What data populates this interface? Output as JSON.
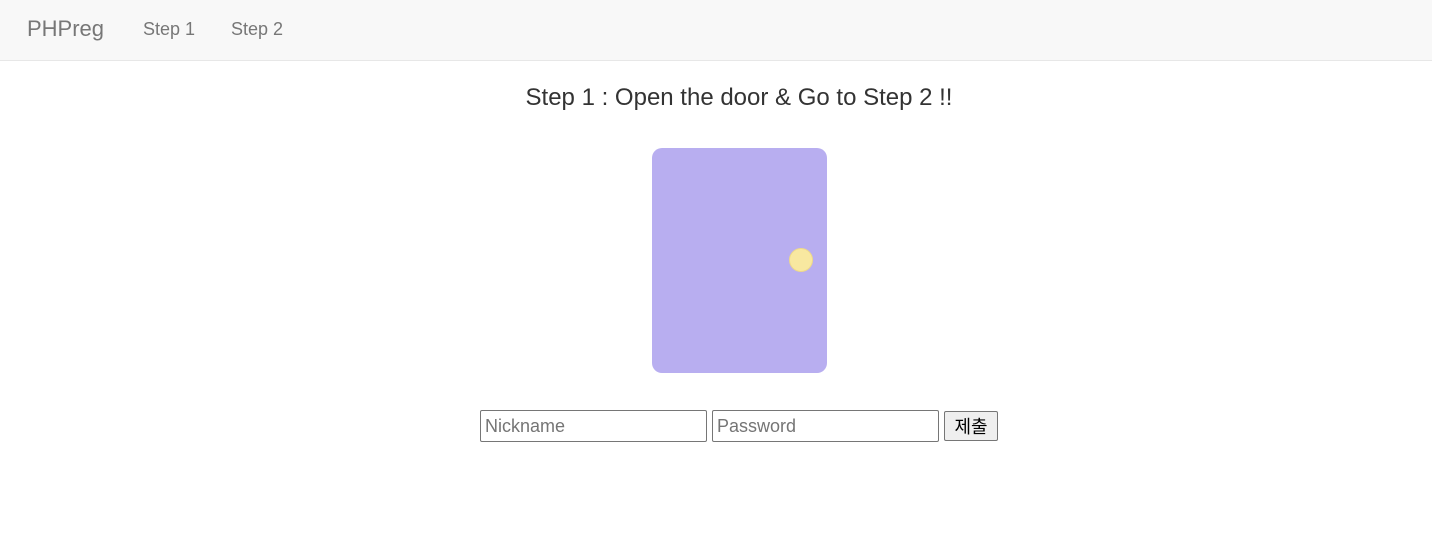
{
  "navbar": {
    "brand": "PHPreg",
    "links": [
      {
        "label": "Step 1"
      },
      {
        "label": "Step 2"
      }
    ]
  },
  "main": {
    "title": "Step 1 : Open the door & Go to Step 2 !!",
    "door": {
      "color": "#b8aef0",
      "knob_color": "#f8e8a0"
    },
    "form": {
      "nickname_placeholder": "Nickname",
      "nickname_value": "",
      "password_placeholder": "Password",
      "password_value": "",
      "submit_label": "제출"
    }
  }
}
